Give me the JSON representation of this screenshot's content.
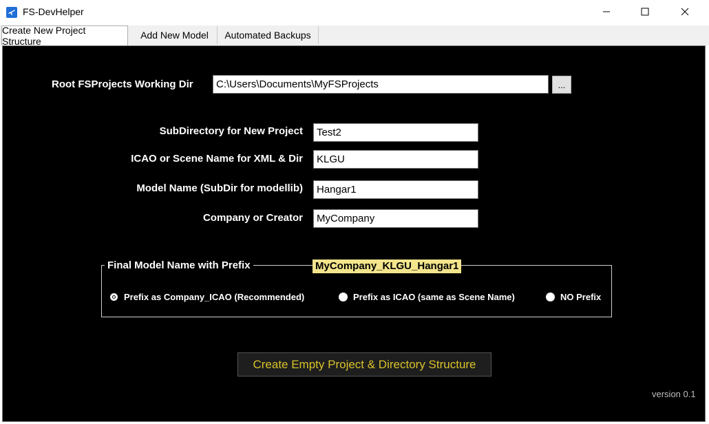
{
  "window": {
    "title": "FS-DevHelper"
  },
  "tabs": [
    {
      "label": "Create New Project Structure"
    },
    {
      "label": "Add New Model"
    },
    {
      "label": "Automated Backups"
    }
  ],
  "form": {
    "root_dir": {
      "label": "Root FSProjects Working Dir",
      "value": "C:\\Users\\Documents\\MyFSProjects",
      "browse_label": "..."
    },
    "subdir": {
      "label": "SubDirectory for New Project",
      "value": "Test2"
    },
    "icao": {
      "label": "ICAO or Scene Name for XML & Dir",
      "value": "KLGU"
    },
    "model": {
      "label": "Model Name (SubDir for modellib)",
      "value": "Hangar1"
    },
    "company": {
      "label": "Company or Creator",
      "value": "MyCompany"
    }
  },
  "prefix_group": {
    "legend": "Final Model Name with Prefix",
    "final_name": "MyCompany_KLGU_Hangar1",
    "options": [
      {
        "label": "Prefix as Company_ICAO (Recommended)",
        "selected": true
      },
      {
        "label": "Prefix as ICAO (same as Scene Name)",
        "selected": false
      },
      {
        "label": "NO Prefix",
        "selected": false
      }
    ]
  },
  "create_button": {
    "label": "Create Empty Project & Directory Structure"
  },
  "version": "version 0.1",
  "colors": {
    "panel_bg": "#000000",
    "highlight": "#f3e58c",
    "button_text": "#d9c22a",
    "icon_blue": "#1f6fd6"
  },
  "icons": {
    "app": "airplane-icon",
    "minimize": "minimize-icon",
    "maximize": "maximize-icon",
    "close": "close-icon"
  }
}
